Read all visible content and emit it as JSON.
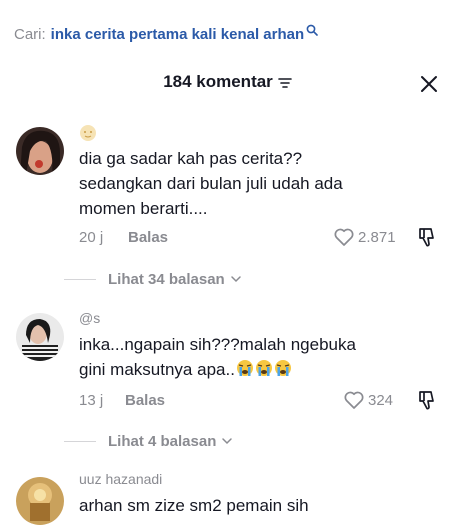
{
  "search": {
    "prefix": "Cari:",
    "query": "inka cerita pertama kali kenal arhan"
  },
  "header": {
    "title": "184 komentar"
  },
  "comments": [
    {
      "username": "",
      "text_lines": [
        "dia ga sadar kah pas cerita??",
        "sedangkan dari bulan juli udah ada",
        "momen berarti...."
      ],
      "time": "20 j",
      "reply_label": "Balas",
      "likes": "2.871",
      "view_replies": "Lihat 34 balasan"
    },
    {
      "username": "@s",
      "text_lines": [
        "inka...ngapain sih???malah ngebuka",
        "gini maksutnya apa.."
      ],
      "emojis": [
        "loudly-crying-face",
        "loudly-crying-face",
        "loudly-crying-face"
      ],
      "time": "13 j",
      "reply_label": "Balas",
      "likes": "324",
      "view_replies": "Lihat 4 balasan"
    },
    {
      "username": "uuz hazanadi",
      "text_lines": [
        "arhan sm zize sm2 pemain sih"
      ]
    }
  ],
  "colors": {
    "query": "#2b5aa8",
    "muted": "#8a8b91",
    "text": "#161823"
  }
}
